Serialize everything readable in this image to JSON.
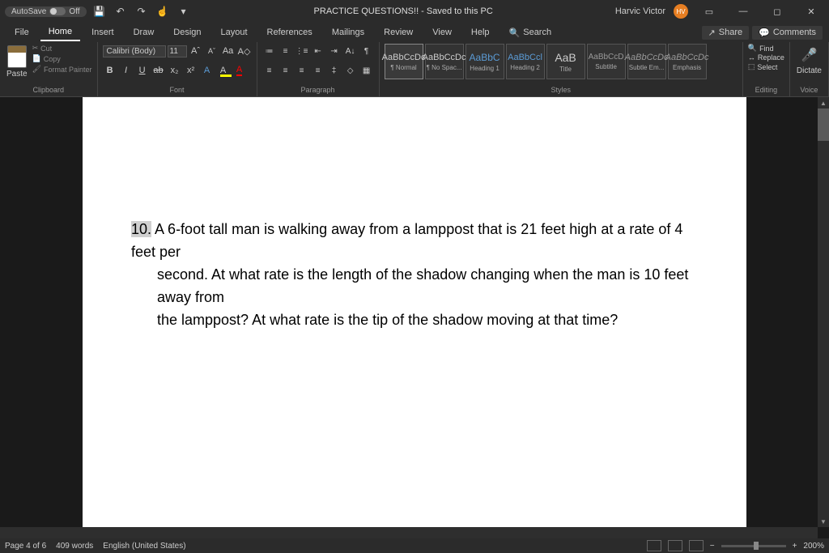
{
  "title": "PRACTICE QUESTIONS!! - Saved to this PC",
  "user": {
    "name": "Harvic Victor",
    "initials": "HV"
  },
  "autosave": {
    "label": "AutoSave",
    "state": "Off"
  },
  "tabs": [
    "File",
    "Home",
    "Insert",
    "Draw",
    "Design",
    "Layout",
    "References",
    "Mailings",
    "Review",
    "View",
    "Help"
  ],
  "active_tab": "Home",
  "search_label": "Search",
  "share_label": "Share",
  "comments_label": "Comments",
  "clipboard": {
    "paste": "Paste",
    "cut": "Cut",
    "copy": "Copy",
    "painter": "Format Painter",
    "label": "Clipboard"
  },
  "font": {
    "name": "Calibri (Body)",
    "size": "11",
    "label": "Font"
  },
  "paragraph": {
    "label": "Paragraph"
  },
  "styles": {
    "label": "Styles",
    "items": [
      {
        "preview": "AaBbCcDc",
        "name": "¶ Normal",
        "cls": ""
      },
      {
        "preview": "AaBbCcDc",
        "name": "¶ No Spac...",
        "cls": ""
      },
      {
        "preview": "AaBbC",
        "name": "Heading 1",
        "cls": "h1"
      },
      {
        "preview": "AaBbCcl",
        "name": "Heading 2",
        "cls": "h2"
      },
      {
        "preview": "AaB",
        "name": "Title",
        "cls": "title"
      },
      {
        "preview": "AaBbCcD",
        "name": "Subtitle",
        "cls": "sub"
      },
      {
        "preview": "AaBbCcDc",
        "name": "Subtle Em...",
        "cls": "em"
      },
      {
        "preview": "AaBbCcDc",
        "name": "Emphasis",
        "cls": "em"
      }
    ]
  },
  "editing": {
    "find": "Find",
    "replace": "Replace",
    "select": "Select",
    "label": "Editing"
  },
  "voice": {
    "dictate": "Dictate",
    "label": "Voice"
  },
  "document": {
    "q_num": "10.",
    "q_line1": " A 6-foot tall man is walking away from a lamppost that is 21 feet high at a rate of 4 feet per",
    "q_line2": "second.  At what rate is the length of the shadow changing when the man is 10 feet away from",
    "q_line3": "the lamppost?  At what rate is the tip of the shadow moving at that time?"
  },
  "status": {
    "page": "Page 4 of 6",
    "words": "409 words",
    "lang": "English (United States)",
    "zoom": "200%"
  }
}
